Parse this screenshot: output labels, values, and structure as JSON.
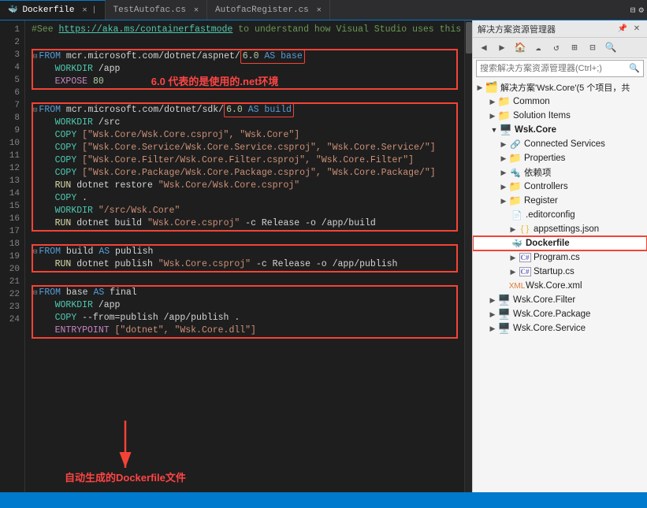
{
  "tabs": [
    {
      "id": "dockerfile",
      "label": "Dockerfile",
      "active": true,
      "modified": false
    },
    {
      "id": "testautofac",
      "label": "TestAutofac.cs",
      "active": false
    },
    {
      "id": "autofacregister",
      "label": "AutofacRegister.cs",
      "active": false
    }
  ],
  "tab_icons": [
    "▾",
    "⊟"
  ],
  "editor": {
    "lines": [
      {
        "num": 1,
        "indent": "",
        "content": "#See https://aka.ms/containerfastmode to understand how Visual Studio uses this Dockerfile to build yo"
      },
      {
        "num": 2,
        "type": "blank"
      },
      {
        "num": 3,
        "type": "from_collapse",
        "content": "FROM mcr.microsoft.com/dotnet/aspnet:",
        "highlight": "6.0 AS base"
      },
      {
        "num": 4,
        "indent": "    ",
        "kw": "WORKDIR",
        "rest": " /app"
      },
      {
        "num": 5,
        "indent": "    ",
        "kw": "EXPOSE",
        "rest": " 80"
      },
      {
        "num": 6,
        "type": "blank"
      },
      {
        "num": 7,
        "type": "from_collapse",
        "content": "FROM mcr.microsoft.com/dotnet/sdk:",
        "highlight": "6.0 AS build"
      },
      {
        "num": 8,
        "indent": "    ",
        "kw": "WORKDIR",
        "rest": " /src"
      },
      {
        "num": 9,
        "indent": "    ",
        "kw": "COPY",
        "rest": " [\"Wsk.Core/Wsk.Core.csproj\", \"Wsk.Core\"]"
      },
      {
        "num": 10,
        "indent": "    ",
        "kw": "COPY",
        "rest": " [\"Wsk.Core.Service/Wsk.Core.Service.csproj\", \"Wsk.Core.Service/\"]"
      },
      {
        "num": 11,
        "indent": "    ",
        "kw": "COPY",
        "rest": " [\"Wsk.Core.Filter/Wsk.Core.Filter.csproj\", \"Wsk.Core.Filter\"]"
      },
      {
        "num": 12,
        "indent": "    ",
        "kw": "COPY",
        "rest": " [\"Wsk.Core.Package/Wsk.Core.Package.csproj\", \"Wsk.Core.Package/\"]"
      },
      {
        "num": 13,
        "indent": "    ",
        "kw": "RUN",
        "rest": " dotnet restore \"Wsk.Core/Wsk.Core.csproj\""
      },
      {
        "num": 14,
        "indent": "    ",
        "kw": "COPY",
        "rest": " ."
      },
      {
        "num": 15,
        "indent": "    ",
        "kw": "WORKDIR",
        "rest": " \"/src/Wsk.Core\""
      },
      {
        "num": 16,
        "indent": "    ",
        "kw": "RUN",
        "rest": " dotnet build \"Wsk.Core.csproj\" -c Release -o /app/build"
      },
      {
        "num": 17,
        "type": "blank"
      },
      {
        "num": 18,
        "type": "from_collapse",
        "content": "FROM build AS publish"
      },
      {
        "num": 19,
        "indent": "    ",
        "kw": "RUN",
        "rest": " dotnet publish \"Wsk.Core.csproj\" -c Release -o /app/publish"
      },
      {
        "num": 20,
        "type": "blank"
      },
      {
        "num": 21,
        "type": "from_collapse",
        "content": "FROM base AS final"
      },
      {
        "num": 22,
        "indent": "    ",
        "kw": "WORKDIR",
        "rest": " /app"
      },
      {
        "num": 23,
        "indent": "    ",
        "kw": "COPY",
        "rest": " --from=publish /app/publish ."
      },
      {
        "num": 24,
        "indent": "    ",
        "kw": "ENTRYPOINT",
        "rest": " [\"dotnet\", \"Wsk.Core.dll\"]"
      }
    ]
  },
  "annotation_env": "6.0 代表的是使用的.net环境",
  "annotation_dockerfile": "自动生成的Dockerfile文件",
  "solution_panel": {
    "title": "解决方案资源管理器",
    "search_placeholder": "搜索解决方案资源管理器(Ctrl+;)",
    "solution_label": "解决方案'Wsk.Core'(5 个项目，共",
    "toolbar_buttons": [
      "⬅",
      "⮕",
      "🏠",
      "☁",
      "🔄",
      "⊞",
      "⊟",
      "🔍"
    ],
    "tree": [
      {
        "id": "solution",
        "level": 0,
        "expanded": true,
        "icon": "solution",
        "label": "解决方案'Wsk.Core'(5 个项目，共"
      },
      {
        "id": "common",
        "level": 1,
        "expanded": false,
        "icon": "folder",
        "label": "Common"
      },
      {
        "id": "solution-items",
        "level": 1,
        "expanded": false,
        "icon": "folder",
        "label": "Solution Items"
      },
      {
        "id": "wsk-core",
        "level": 1,
        "expanded": true,
        "icon": "project",
        "label": "Wsk.Core"
      },
      {
        "id": "connected-services",
        "level": 2,
        "expanded": false,
        "icon": "service",
        "label": "Connected Services"
      },
      {
        "id": "properties",
        "level": 2,
        "expanded": false,
        "icon": "folder",
        "label": "Properties"
      },
      {
        "id": "dependencies",
        "level": 2,
        "expanded": false,
        "icon": "ref",
        "label": "依赖项"
      },
      {
        "id": "controllers",
        "level": 2,
        "expanded": false,
        "icon": "folder",
        "label": "Controllers"
      },
      {
        "id": "register",
        "level": 2,
        "expanded": false,
        "icon": "folder",
        "label": "Register"
      },
      {
        "id": "editorconfig",
        "level": 2,
        "expanded": false,
        "icon": "editorconfig",
        "label": ".editorconfig"
      },
      {
        "id": "appsettings",
        "level": 2,
        "expanded": false,
        "icon": "json",
        "label": "appsettings.json"
      },
      {
        "id": "dockerfile",
        "level": 2,
        "expanded": false,
        "icon": "docker",
        "label": "Dockerfile",
        "selected": true
      },
      {
        "id": "programcs",
        "level": 2,
        "expanded": false,
        "icon": "csharp",
        "label": "Program.cs"
      },
      {
        "id": "startupcs",
        "level": 2,
        "expanded": false,
        "icon": "csharp",
        "label": "Startup.cs"
      },
      {
        "id": "wsk-core-xml",
        "level": 2,
        "expanded": false,
        "icon": "xml",
        "label": "Wsk.Core.xml"
      },
      {
        "id": "wsk-core-filter",
        "level": 1,
        "expanded": false,
        "icon": "project",
        "label": "Wsk.Core.Filter"
      },
      {
        "id": "wsk-core-package",
        "level": 1,
        "expanded": false,
        "icon": "project",
        "label": "Wsk.Core.Package"
      },
      {
        "id": "wsk-core-service",
        "level": 1,
        "expanded": false,
        "icon": "project",
        "label": "Wsk.Core.Service"
      }
    ]
  }
}
